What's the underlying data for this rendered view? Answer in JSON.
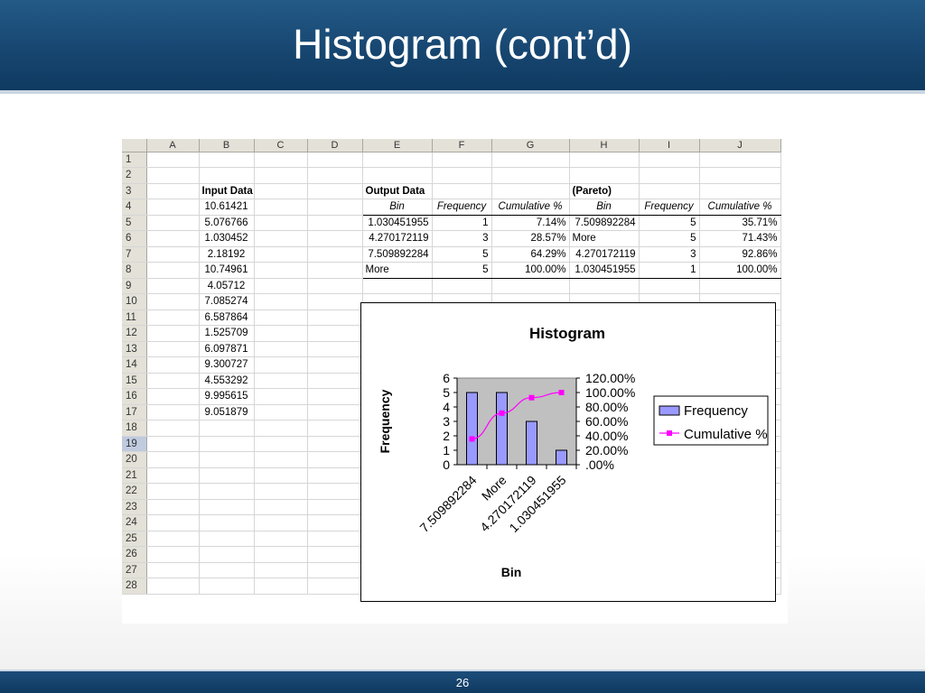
{
  "slide": {
    "title": "Histogram (cont’d)",
    "page_number": "26"
  },
  "sheet": {
    "columns": [
      "A",
      "B",
      "C",
      "D",
      "E",
      "F",
      "G",
      "H",
      "I",
      "J"
    ],
    "rows": [
      "1",
      "2",
      "3",
      "4",
      "5",
      "6",
      "7",
      "8",
      "9",
      "10",
      "11",
      "12",
      "13",
      "14",
      "15",
      "16",
      "17",
      "18",
      "19",
      "20",
      "21",
      "22",
      "23",
      "24",
      "25",
      "26",
      "27",
      "28"
    ],
    "selected_row": "19",
    "input_header": "Input Data",
    "input_data": [
      "10.61421",
      "5.076766",
      "1.030452",
      "2.18192",
      "10.74961",
      "4.05712",
      "7.085274",
      "6.587864",
      "1.525709",
      "6.097871",
      "9.300727",
      "4.553292",
      "9.995615",
      "9.051879"
    ],
    "output_header": "Output Data",
    "pareto_header": "(Pareto)",
    "table_headers": [
      "Bin",
      "Frequency",
      "Cumulative %",
      "Bin",
      "Frequency",
      "Cumulative %"
    ],
    "output_rows": [
      [
        "1.030451955",
        "1",
        "7.14%",
        "7.509892284",
        "5",
        "35.71%"
      ],
      [
        "4.270172119",
        "3",
        "28.57%",
        "More",
        "5",
        "71.43%"
      ],
      [
        "7.509892284",
        "5",
        "64.29%",
        "4.270172119",
        "3",
        "92.86%"
      ],
      [
        "More",
        "5",
        "100.00%",
        "1.030451955",
        "1",
        "100.00%"
      ]
    ]
  },
  "chart_data": {
    "type": "bar",
    "title": "Histogram",
    "xlabel": "Bin",
    "ylabel": "Frequency",
    "categories": [
      "7.509892284",
      "More",
      "4.270172119",
      "1.030451955"
    ],
    "series": [
      {
        "name": "Frequency",
        "type": "bar",
        "values": [
          5,
          5,
          3,
          1
        ],
        "color": "#9999ff"
      },
      {
        "name": "Cumulative %",
        "type": "line",
        "axis": "right",
        "values": [
          35.71,
          71.43,
          92.86,
          100.0
        ],
        "color": "#ff00ff"
      }
    ],
    "ylim": [
      0,
      6
    ],
    "y_ticks": [
      "0",
      "1",
      "2",
      "3",
      "4",
      "5",
      "6"
    ],
    "y2lim": [
      0,
      120
    ],
    "y2_ticks": [
      ".00%",
      "20.00%",
      "40.00%",
      "60.00%",
      "80.00%",
      "100.00%",
      "120.00%"
    ],
    "legend_position": "right",
    "plot_background": "#c0c0c0"
  }
}
